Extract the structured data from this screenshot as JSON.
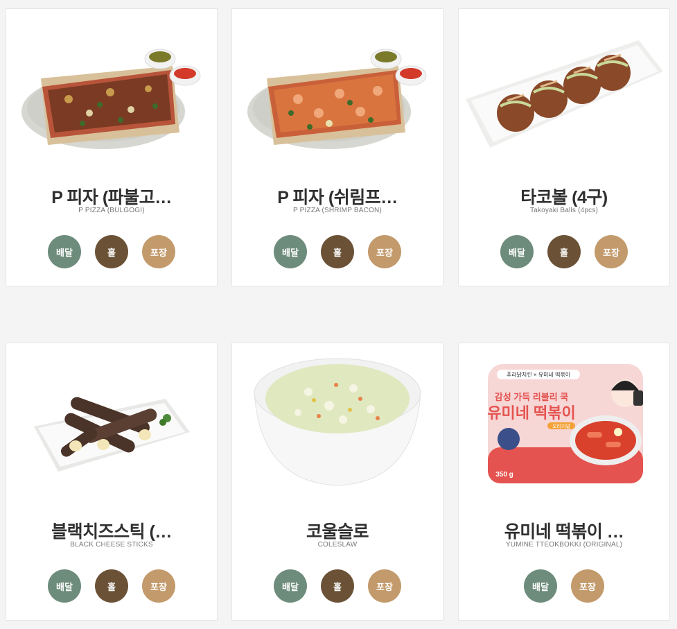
{
  "menu": {
    "items": [
      {
        "name_ko": "P 피자 (파불고…",
        "name_en": "P PIZZA (BULGOGI)",
        "buttons": [
          "배달",
          "홀",
          "포장"
        ],
        "image": "bulgogi-pizza"
      },
      {
        "name_ko": "P 피자 (쉬림프…",
        "name_en": "P PIZZA (SHRIMP BACON)",
        "buttons": [
          "배달",
          "홀",
          "포장"
        ],
        "image": "shrimp-pizza"
      },
      {
        "name_ko": "타코볼 (4구)",
        "name_en": "Takoyaki Balls (4pcs)",
        "buttons": [
          "배달",
          "홀",
          "포장"
        ],
        "image": "takoyaki"
      },
      {
        "name_ko": "블랙치즈스틱 (…",
        "name_en": "BLACK CHEESE STICKS",
        "buttons": [
          "배달",
          "홀",
          "포장"
        ],
        "image": "cheese-sticks"
      },
      {
        "name_ko": "코울슬로",
        "name_en": "COLESLAW",
        "buttons": [
          "배달",
          "홀",
          "포장"
        ],
        "image": "coleslaw"
      },
      {
        "name_ko": "유미네 떡볶이 …",
        "name_en": "YUMINE TTEOKBOKKI (ORIGINAL)",
        "buttons": [
          "배달",
          "포장"
        ],
        "image": "tteokbokki-pack"
      }
    ]
  },
  "package_text": {
    "brand": "푸라닭치킨 × 유미네 떡볶이",
    "slogan": "감성 가득 리블리 쿡",
    "title": "유미네 떡볶이",
    "subtitle": "오리지널",
    "weight": "350 g"
  },
  "colors": {
    "delivery": "#6e8c7c",
    "hall": "#6b5237",
    "takeout": "#c39a6b"
  }
}
